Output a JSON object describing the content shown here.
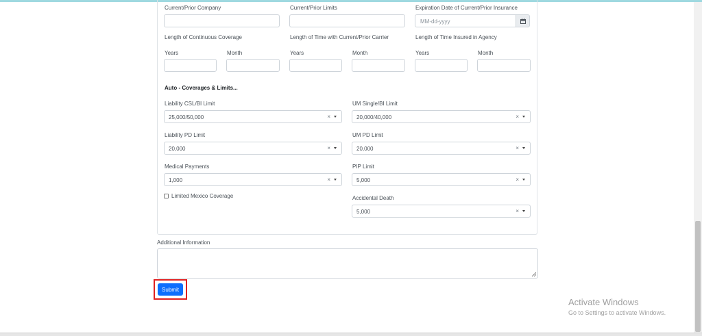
{
  "prior_insurance": {
    "company_label": "Current/Prior Company",
    "limits_label": "Current/Prior Limits",
    "expiration_label": "Expiration Date of Current/Prior Insurance",
    "expiration_placeholder": "MM-dd-yyyy",
    "continuous_coverage_label": "Length of Continuous Coverage",
    "time_with_carrier_label": "Length of Time with Current/Prior Carrier",
    "time_insured_label": "Length of Time Insured in Agency",
    "years_label": "Years",
    "month_label": "Month"
  },
  "coverages": {
    "title": "Auto - Coverages & Limits...",
    "liability_csl_label": "Liability CSL/BI Limit",
    "liability_csl_value": "25,000/50,000",
    "um_single_label": "UM Single/BI Limit",
    "um_single_value": "20,000/40,000",
    "liability_pd_label": "Liability PD Limit",
    "liability_pd_value": "20,000",
    "um_pd_label": "UM PD Limit",
    "um_pd_value": "20,000",
    "medical_label": "Medical Payments",
    "medical_value": "1,000",
    "pip_label": "PIP Limit",
    "pip_value": "5,000",
    "mexico_label": "Limited Mexico Coverage",
    "mexico_checked": false,
    "accidental_label": "Accidental Death",
    "accidental_value": "5,000",
    "clear_glyph": "×"
  },
  "additional": {
    "label": "Additional Information"
  },
  "submit_label": "Submit",
  "watermark": {
    "title": "Activate Windows",
    "subtitle": "Go to Settings to activate Windows."
  },
  "icons": {
    "calendar": "calendar-icon",
    "caret": "caret-down-icon",
    "grip": "resize-grip-icon"
  },
  "colors": {
    "primary": "#0d6efd",
    "highlight": "#e02020",
    "border": "#ced4da"
  }
}
